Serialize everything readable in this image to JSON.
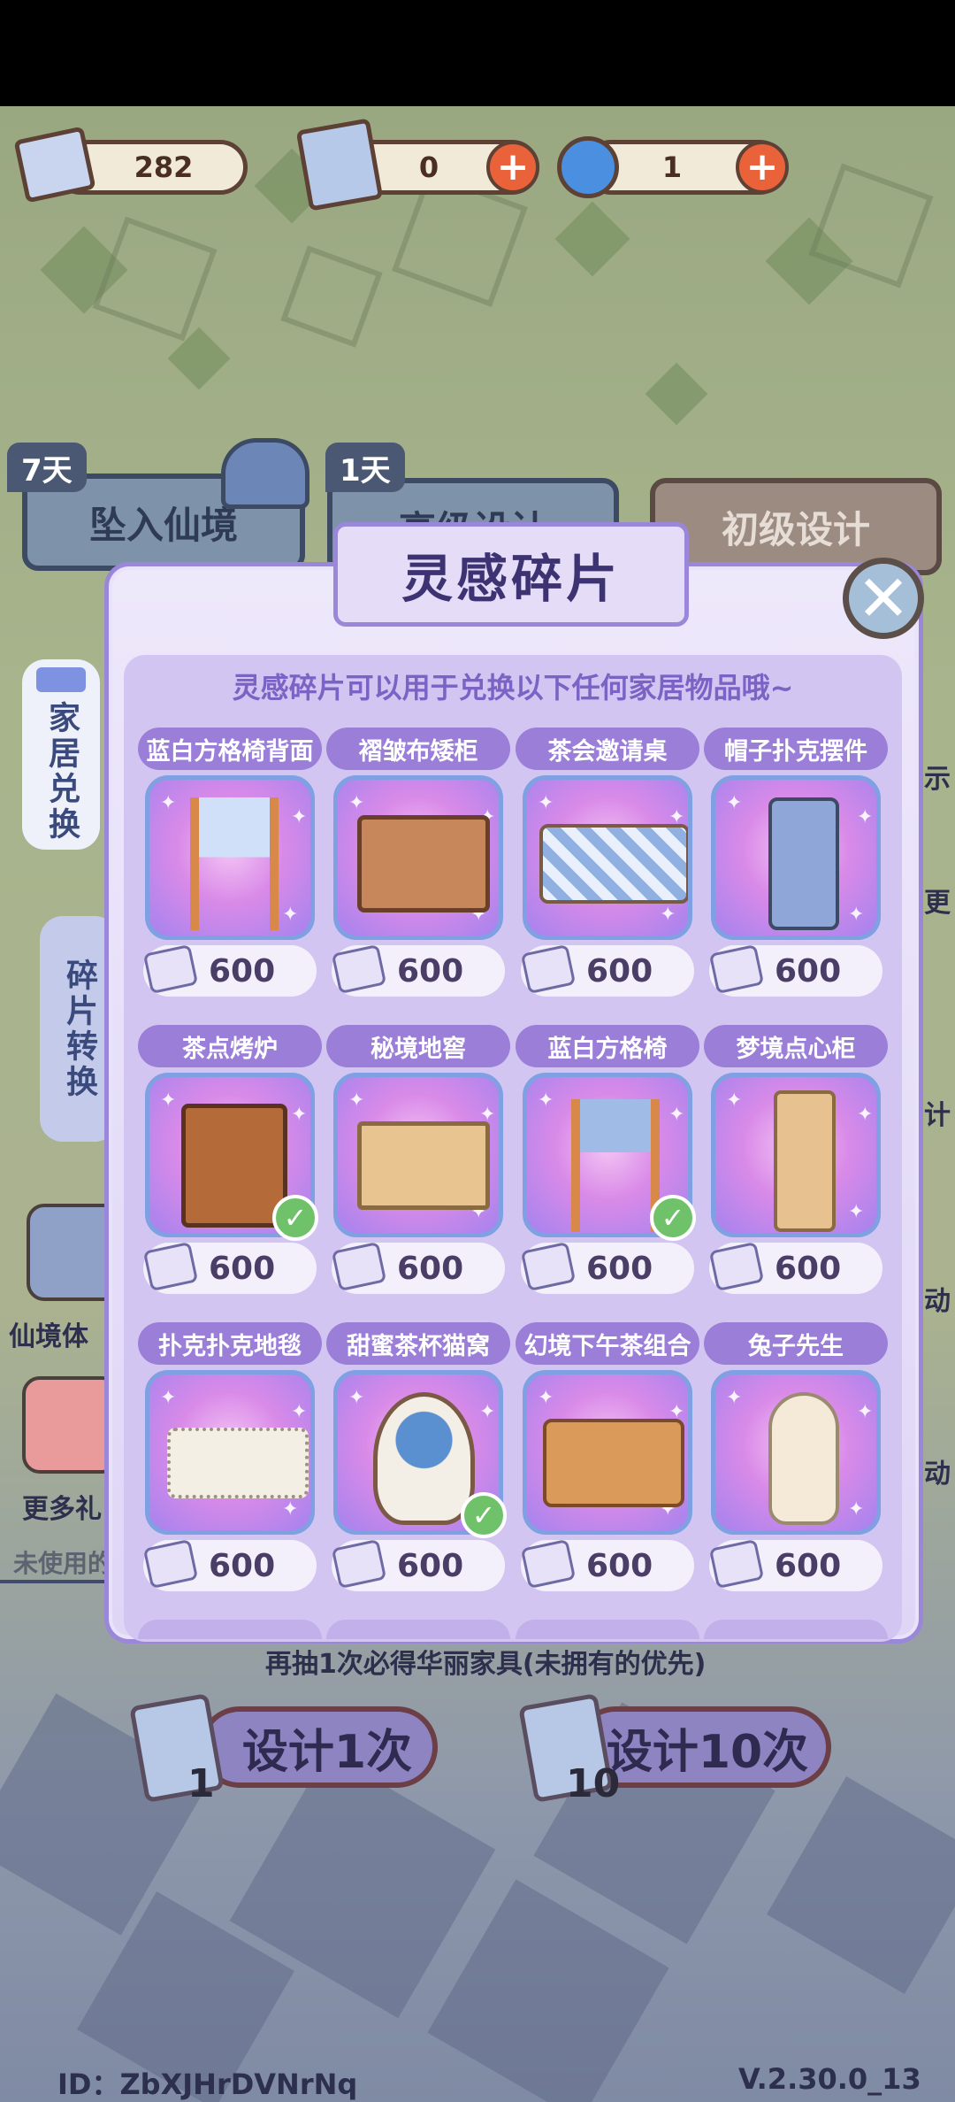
{
  "currency": {
    "fragments": "282",
    "scrolls": "0",
    "spirals": "1"
  },
  "background": {
    "tab1": {
      "label": "坠入仙境",
      "days": "7天"
    },
    "tab2": {
      "label": "高级设计",
      "days": "1天"
    },
    "tab3": {
      "label": "初级设计"
    },
    "side_home_exchange": "家居兑换",
    "side_fragment_convert": "碎片转换",
    "left_label_1": "仙境体",
    "left_label_2": "更多礼",
    "left_label_3": "未使用的",
    "right_label_1": "示",
    "right_label_2": "更",
    "right_label_3": "计",
    "right_label_4": "动",
    "right_label_5": "动",
    "hint_text": "再抽1次必得华丽家具(未拥有的优先)"
  },
  "modal": {
    "title": "灵感碎片",
    "description": "灵感碎片可以用于兑换以下任何家居物品哦~",
    "items": [
      {
        "name": "蓝白方格椅背面",
        "price": "600",
        "owned": false
      },
      {
        "name": "褶皱布矮柜",
        "price": "600",
        "owned": false
      },
      {
        "name": "茶会邀请桌",
        "price": "600",
        "owned": false
      },
      {
        "name": "帽子扑克摆件",
        "price": "600",
        "owned": false
      },
      {
        "name": "茶点烤炉",
        "price": "600",
        "owned": true
      },
      {
        "name": "秘境地窖",
        "price": "600",
        "owned": false
      },
      {
        "name": "蓝白方格椅",
        "price": "600",
        "owned": true
      },
      {
        "name": "梦境点心柜",
        "price": "600",
        "owned": false
      },
      {
        "name": "扑克扑克地毯",
        "price": "600",
        "owned": false
      },
      {
        "name": "甜蜜茶杯猫窝",
        "price": "600",
        "owned": true
      },
      {
        "name": "幻境下午茶组合",
        "price": "600",
        "owned": false
      },
      {
        "name": "兔子先生",
        "price": "600",
        "owned": false
      }
    ]
  },
  "design": {
    "once_label": "设计1次",
    "once_count": "1",
    "ten_label": "设计10次",
    "ten_count": "10"
  },
  "footer": {
    "id": "ID：ZbXJHrDVNrNq",
    "version": "V.2.30.0_13"
  },
  "colors": {
    "accent_purple": "#9a7ed8",
    "plus_orange": "#e9623a",
    "owned_green": "#6fc16a"
  }
}
